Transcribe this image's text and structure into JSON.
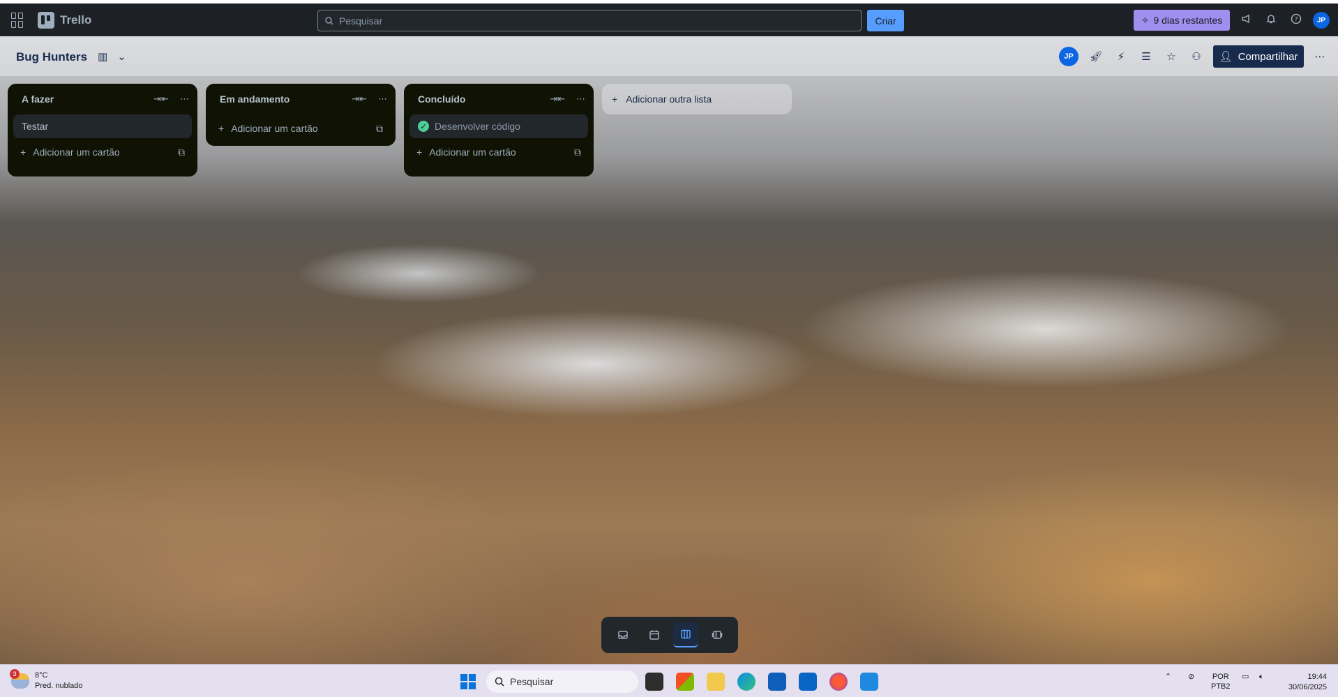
{
  "topbar": {
    "app_name": "Trello",
    "search_placeholder": "Pesquisar",
    "create_label": "Criar",
    "trial_label": "9 dias restantes",
    "avatar_initials": "JP"
  },
  "board": {
    "title": "Bug Hunters",
    "avatar_initials": "JP",
    "share_label": "Compartilhar"
  },
  "lists": [
    {
      "title": "A fazer",
      "cards": [
        {
          "title": "Testar",
          "done": false
        }
      ],
      "add_card_label": "Adicionar um cartão"
    },
    {
      "title": "Em andamento",
      "cards": [],
      "add_card_label": "Adicionar um cartão"
    },
    {
      "title": "Concluído",
      "cards": [
        {
          "title": "Desenvolver código",
          "done": true
        }
      ],
      "add_card_label": "Adicionar um cartão"
    }
  ],
  "add_list_label": "Adicionar outra lista",
  "view_switcher": {
    "active": "board",
    "items": [
      "inbox-icon",
      "calendar-icon",
      "board-icon",
      "switch-boards-icon"
    ]
  },
  "taskbar": {
    "weather_temp": "8°C",
    "weather_desc": "Pred. nublado",
    "weather_badge": "3",
    "search_label": "Pesquisar",
    "lang": "POR",
    "layout": "PTB2",
    "time": "19:44",
    "date": "30/06/2025"
  },
  "colors": {
    "topbar_bg": "#1d2125",
    "list_bg": "#101204",
    "create_btn": "#579dff",
    "trial_btn": "#9f8fef",
    "done_check": "#4bce97",
    "share_btn": "#172b4d"
  }
}
